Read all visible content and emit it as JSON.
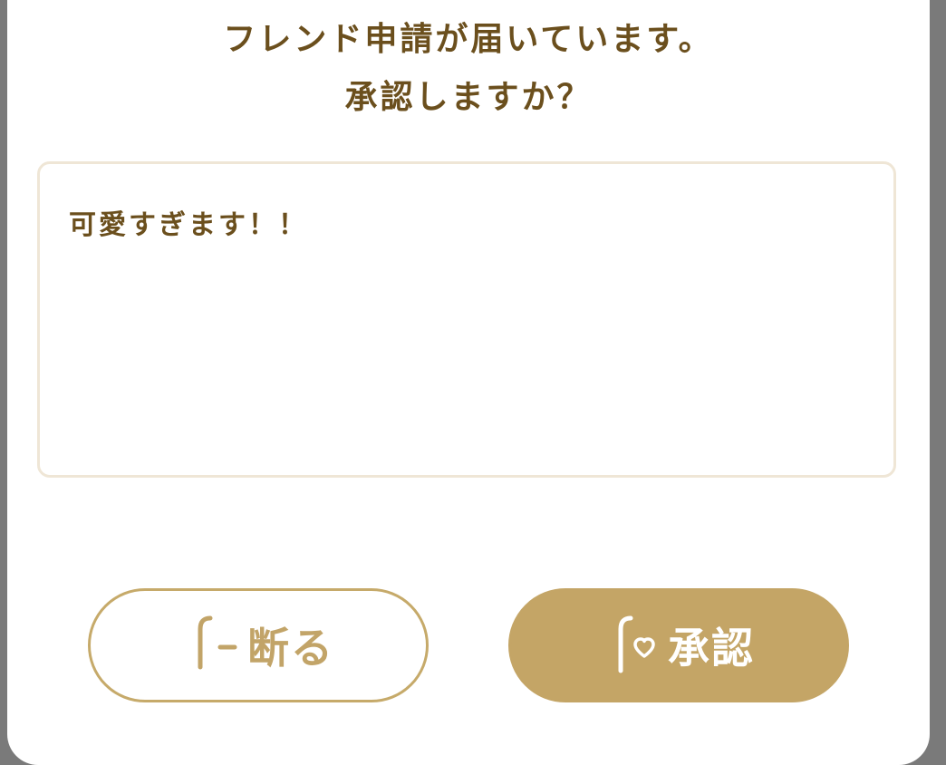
{
  "dialog": {
    "title_line1": "フレンド申請が届いています。",
    "title_line2": "承認しますか？",
    "message": "可愛すぎます！！"
  },
  "buttons": {
    "decline_label": "断る",
    "accept_label": "承認",
    "decline_icon": "f-minus-icon",
    "accept_icon": "f-heart-icon"
  },
  "colors": {
    "text_brown": "#6b4f1d",
    "gold": "#c4a566",
    "box_border": "#efe6d6",
    "backdrop": "#7a7a7a"
  }
}
